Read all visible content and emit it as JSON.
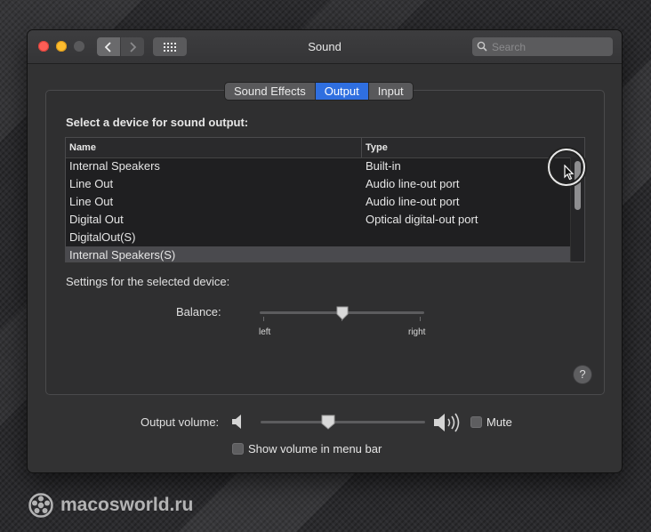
{
  "window": {
    "title": "Sound",
    "search": {
      "placeholder": "Search",
      "value": ""
    }
  },
  "icons": {
    "back": "chevron-left-icon",
    "forward": "chevron-right-icon",
    "show_all": "grid-icon",
    "search": "search-icon",
    "volume_low": "speaker-low-icon",
    "volume_high": "speaker-high-icon",
    "cursor": "pointer-cursor-icon"
  },
  "tabs": [
    {
      "label": "Sound Effects",
      "active": false
    },
    {
      "label": "Output",
      "active": true
    },
    {
      "label": "Input",
      "active": false
    }
  ],
  "output": {
    "heading": "Select a device for sound output:",
    "columns": {
      "name": "Name",
      "type": "Type"
    },
    "devices": [
      {
        "name": "Internal Speakers",
        "type": "Built-in"
      },
      {
        "name": "Line Out",
        "type": "Audio line-out port"
      },
      {
        "name": "Line Out",
        "type": "Audio line-out port"
      },
      {
        "name": "Digital Out",
        "type": "Optical digital-out port"
      },
      {
        "name": "DigitalOut(S)",
        "type": ""
      },
      {
        "name": "Internal Speakers(S)",
        "type": ""
      }
    ],
    "selected_index": 5,
    "settings_label": "Settings for the selected device:",
    "balance": {
      "label": "Balance:",
      "left": "left",
      "right": "right",
      "value": 0.5
    },
    "help": "?"
  },
  "volume": {
    "label": "Output volume:",
    "value": 0.4,
    "mute_label": "Mute",
    "mute_checked": false,
    "show_in_menu_bar_label": "Show volume in menu bar",
    "show_in_menu_bar_checked": false
  },
  "watermark": {
    "text": "macosworld.ru"
  },
  "colors": {
    "accent": "#2f6fe0",
    "window": "#323233"
  }
}
